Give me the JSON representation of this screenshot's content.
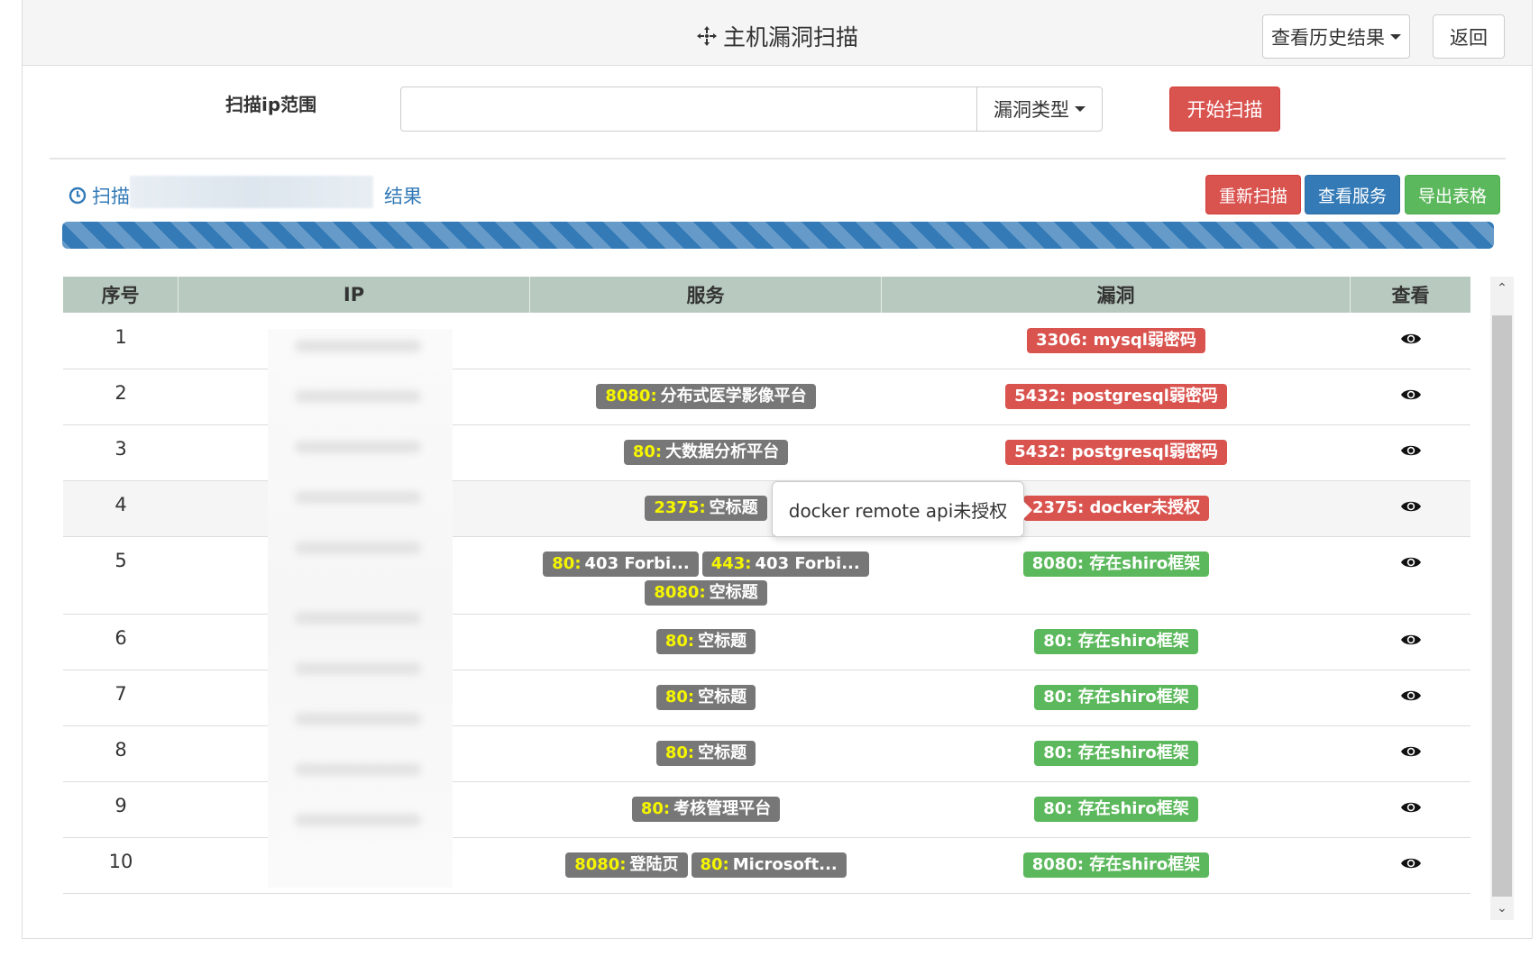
{
  "header": {
    "title": "主机漏洞扫描",
    "history_button": "查看历史结果",
    "back_button": "返回"
  },
  "form": {
    "label": "扫描ip范围",
    "ip_input_value": "",
    "vuln_type_dropdown": "漏洞类型",
    "start_button": "开始扫描"
  },
  "results": {
    "title_prefix": "扫描",
    "title_suffix": "结果",
    "rescan_button": "重新扫描",
    "view_services_button": "查看服务",
    "export_button": "导出表格",
    "progress": 1.0,
    "columns": [
      "序号",
      "IP",
      "服务",
      "漏洞",
      "查看"
    ],
    "rows": [
      {
        "no": "1",
        "services": [],
        "vulns": [
          {
            "text": "3306: mysql弱密码",
            "color": "red"
          }
        ]
      },
      {
        "no": "2",
        "services": [
          {
            "port": "8080:",
            "name": "分布式医学影像平台"
          }
        ],
        "vulns": [
          {
            "text": "5432: postgresql弱密码",
            "color": "red"
          }
        ]
      },
      {
        "no": "3",
        "services": [
          {
            "port": "80:",
            "name": "大数据分析平台"
          }
        ],
        "vulns": [
          {
            "text": "5432: postgresql弱密码",
            "color": "red"
          }
        ]
      },
      {
        "no": "4",
        "services": [
          {
            "port": "2375:",
            "name": "空标题"
          }
        ],
        "vulns": [
          {
            "text": "2375: docker未授权",
            "color": "red"
          }
        ]
      },
      {
        "no": "5",
        "services": [
          {
            "port": "80:",
            "name": "403 Forbi..."
          },
          {
            "port": "443:",
            "name": "403 Forbi..."
          },
          {
            "port": "8080:",
            "name": "空标题"
          }
        ],
        "vulns": [
          {
            "text": "8080: 存在shiro框架",
            "color": "green"
          }
        ]
      },
      {
        "no": "6",
        "services": [
          {
            "port": "80:",
            "name": "空标题"
          }
        ],
        "vulns": [
          {
            "text": "80: 存在shiro框架",
            "color": "green"
          }
        ]
      },
      {
        "no": "7",
        "services": [
          {
            "port": "80:",
            "name": "空标题"
          }
        ],
        "vulns": [
          {
            "text": "80: 存在shiro框架",
            "color": "green"
          }
        ]
      },
      {
        "no": "8",
        "services": [
          {
            "port": "80:",
            "name": "空标题"
          }
        ],
        "vulns": [
          {
            "text": "80: 存在shiro框架",
            "color": "green"
          }
        ]
      },
      {
        "no": "9",
        "services": [
          {
            "port": "80:",
            "name": "考核管理平台"
          }
        ],
        "vulns": [
          {
            "text": "80: 存在shiro框架",
            "color": "green"
          }
        ]
      },
      {
        "no": "10",
        "services": [
          {
            "port": "8080:",
            "name": "登陆页"
          },
          {
            "port": "80:",
            "name": "Microsoft..."
          }
        ],
        "vulns": [
          {
            "text": "8080: 存在shiro框架",
            "color": "green"
          }
        ]
      }
    ],
    "tooltip": "docker remote api未授权"
  },
  "icons": {
    "title_icon": "crosshair-icon",
    "result_icon": "clock-icon",
    "view_icon": "eye-icon"
  }
}
